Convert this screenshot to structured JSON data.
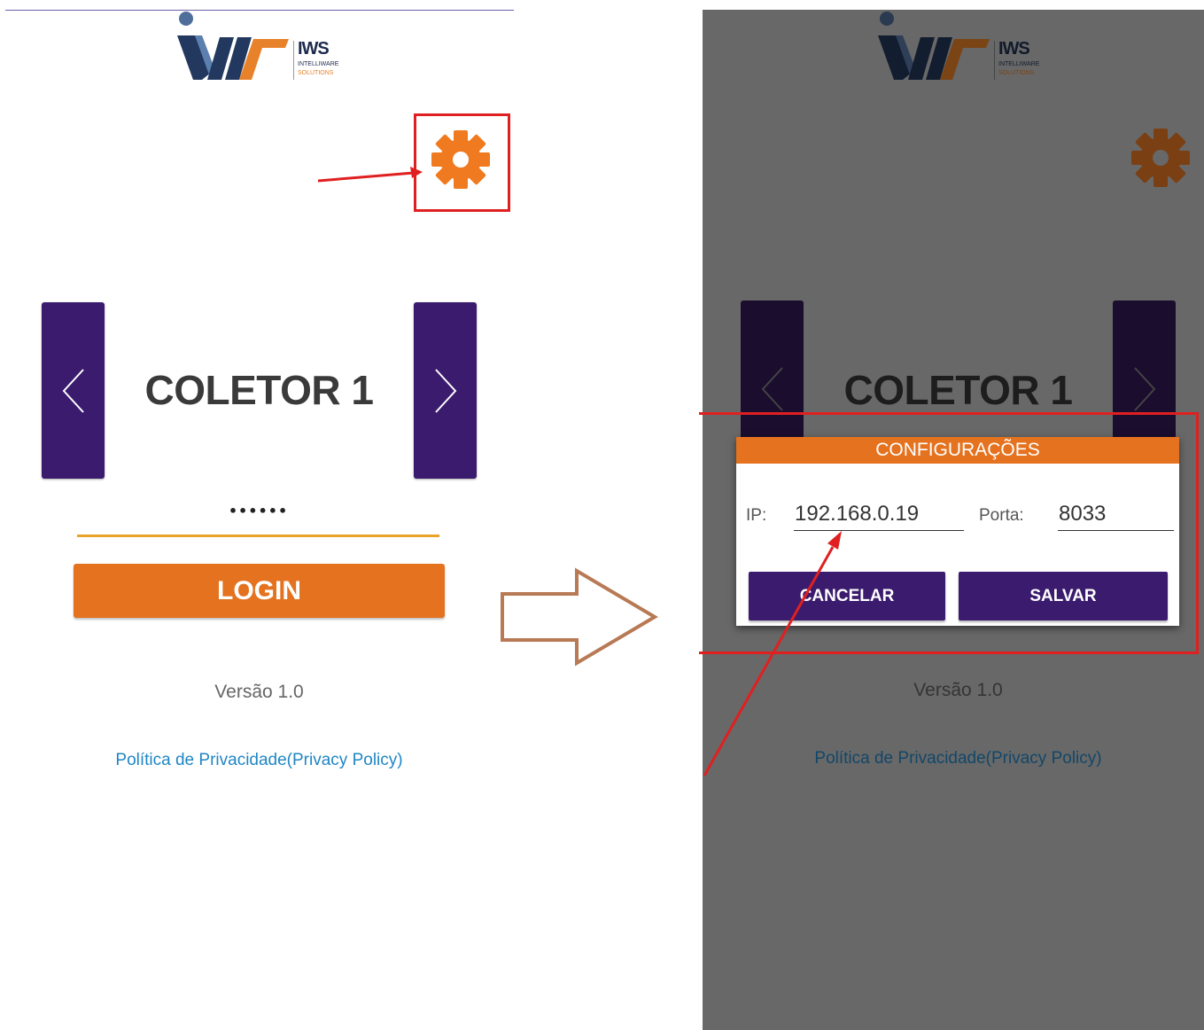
{
  "logo": {
    "name": "IWS",
    "subtitle": "INTELLIWARE",
    "subtitle2": "SOLUTIONS"
  },
  "left_screen": {
    "collector_label": "COLETOR 1",
    "password_masked": "••••••",
    "login_label": "LOGIN",
    "version": "Versão 1.0",
    "privacy_link": "Política de Privacidade(Privacy Policy)"
  },
  "right_screen": {
    "collector_label": "COLETOR 1",
    "version": "Versão 1.0",
    "privacy_link": "Política de Privacidade(Privacy Policy)",
    "dialog": {
      "title": "CONFIGURAÇÕES",
      "ip_label": "IP:",
      "ip_value": "192.168.0.19",
      "port_label": "Porta:",
      "port_value": "8033",
      "cancel_label": "CANCELAR",
      "save_label": "SALVAR"
    }
  },
  "colors": {
    "brand_purple": "#3b1b6e",
    "brand_orange": "#e4721f",
    "annotation_red": "#e02020",
    "annotation_arrow_brown": "#b87a55"
  },
  "icons": [
    "gear-icon",
    "chevron-left-icon",
    "chevron-right-icon"
  ]
}
